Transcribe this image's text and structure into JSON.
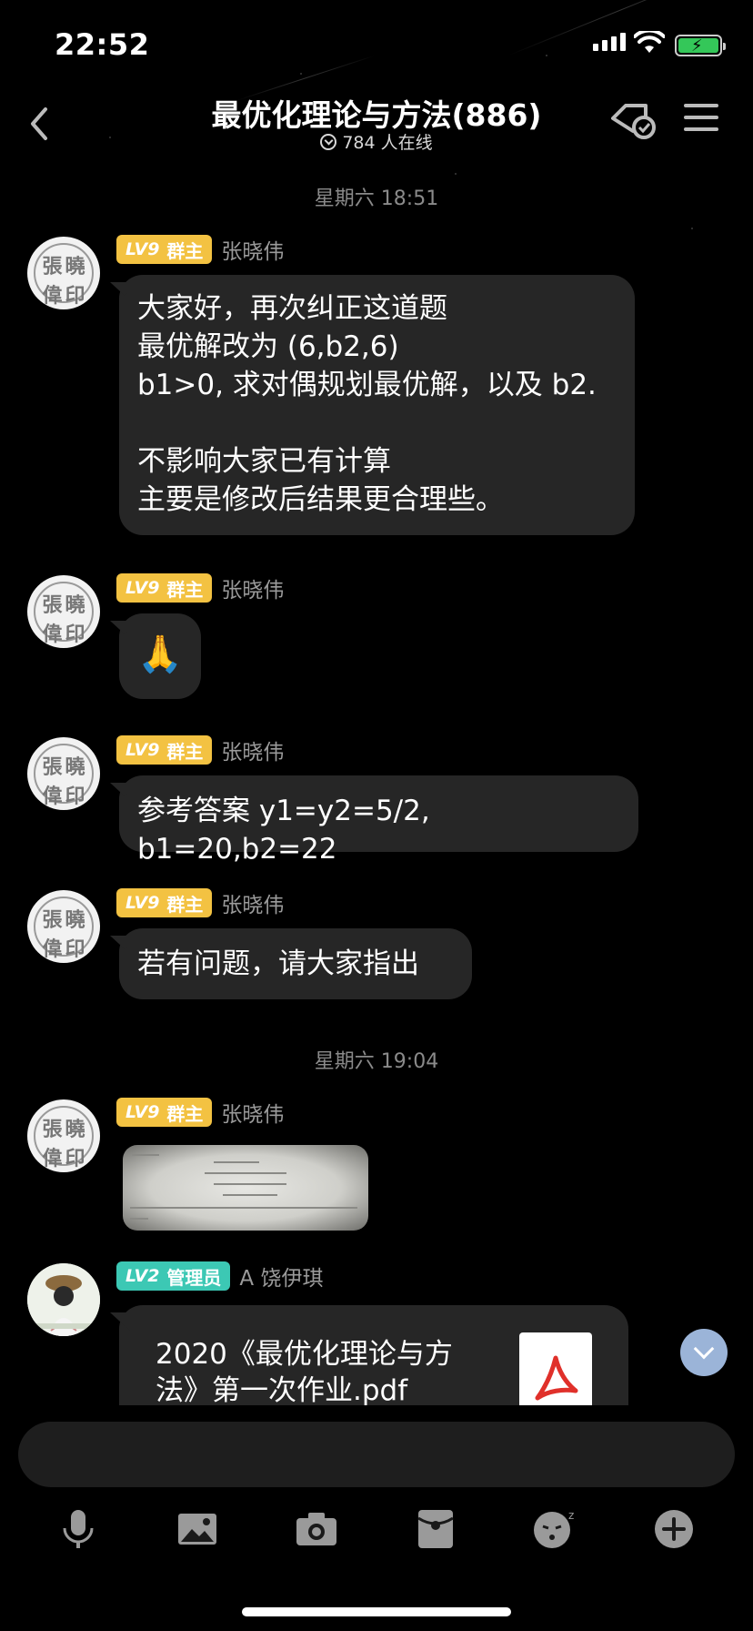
{
  "status_bar": {
    "time": "22:52"
  },
  "header": {
    "title": "最优化理论与方法(886)",
    "online": "784 人在线",
    "icons": [
      "back-chevron-icon",
      "task-icon",
      "menu-icon"
    ]
  },
  "timestamps": [
    "星期六 18:51",
    "星期六 19:04"
  ],
  "messages": [
    {
      "level": "LV9",
      "role": "群主",
      "sender": "张晓伟",
      "text": "大家好，再次纠正这道题\n最优解改为 (6,b2,6)\nb1>0, 求对偶规划最优解，以及 b2.\n\n不影响大家已有计算\n主要是修改后结果更合理些。"
    },
    {
      "level": "LV9",
      "role": "群主",
      "sender": "张晓伟",
      "text": "🙏"
    },
    {
      "level": "LV9",
      "role": "群主",
      "sender": "张晓伟",
      "text": "参考答案 y1=y2=5/2, b1=20,b2=22"
    },
    {
      "level": "LV9",
      "role": "群主",
      "sender": "张晓伟",
      "text": "若有问题，请大家指出"
    },
    {
      "level": "LV9",
      "role": "群主",
      "sender": "张晓伟",
      "type": "image"
    },
    {
      "level": "LV2",
      "role": "管理员",
      "sender": "A 饶伊琪",
      "type": "file",
      "file_name": "2020《最优化理论与方法》第一次作业.pdf"
    }
  ],
  "avatar_seal_chars": [
    "張",
    "曉",
    "偉",
    "印"
  ],
  "input": {
    "placeholder": ""
  },
  "toolbar": [
    "microphone-icon",
    "image-icon",
    "camera-icon",
    "red-packet-icon",
    "emoji-icon",
    "plus-icon"
  ],
  "colors": {
    "owner_badge": "#f3c242",
    "admin_badge": "#3cc8b4",
    "bubble": "#262626",
    "battery": "#34c759"
  }
}
